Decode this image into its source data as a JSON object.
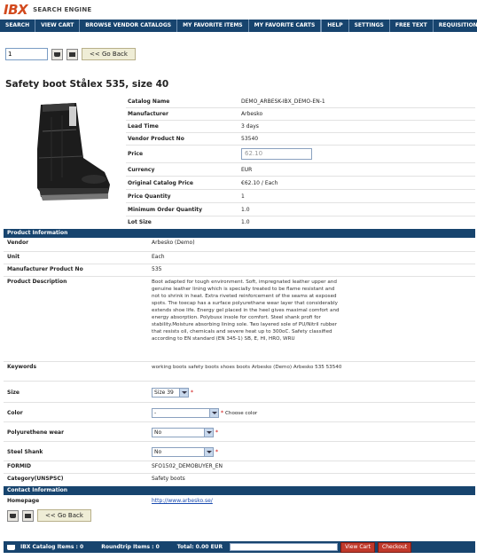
{
  "logo": "IBX",
  "logo_subtitle": "SEARCH ENGINE",
  "nav": {
    "left": [
      "SEARCH",
      "VIEW CART",
      "BROWSE VENDOR CATALOGS",
      "MY FAVORITE ITEMS",
      "MY FAVORITE CARTS"
    ],
    "right": [
      "HELP",
      "SETTINGS",
      "FREE TEXT",
      "REQUISITION"
    ]
  },
  "toolbar": {
    "quantity": "1",
    "back_label": "<< Go Back"
  },
  "product": {
    "title": "Safety boot Stålex 535, size 40",
    "specs": [
      {
        "label": "Catalog Name",
        "value": "DEMO_ARBESK-IBX_DEMO-EN-1"
      },
      {
        "label": "Manufacturer",
        "value": "Arbesko"
      },
      {
        "label": "Lead Time",
        "value": "3 days"
      },
      {
        "label": "Vendor Product No",
        "value": "53540"
      },
      {
        "label": "Price",
        "value": "62.10"
      },
      {
        "label": "Currency",
        "value": "EUR"
      },
      {
        "label": "Original Catalog Price",
        "value": "€62.10  /  Each"
      },
      {
        "label": "Price Quantity",
        "value": "1"
      },
      {
        "label": "Minimum Order Quantity",
        "value": "1.0"
      },
      {
        "label": "Lot Size",
        "value": "1.0"
      }
    ]
  },
  "product_info": {
    "heading": "Product Information",
    "vendor_label": "Vendor",
    "vendor_value": "Arbesko (Demo)",
    "unit_label": "Unit",
    "unit_value": "Each",
    "mpn_label": "Manufacturer Product No",
    "mpn_value": "535",
    "description_label": "Product Description",
    "description_value": "Boot adapted for tough environment. Soft, impregnated leather upper and genuine leather lining which is specially treated to be flame resistant and not to shrink in heat. Extra riveted reinforcement of the seams at exposed spots. The toecap has a surface polyurethane wear layer that considerably extends shoe life. Energy gel placed in the heel gives maximal comfort and energy absorption. Polybusx insole for comfort. Steel shank profi for stability.Moisture absorbing lining sole. Two layered sole of PU/Nitril rubber that resists oil, chemicals and severe heat up to 300oC. Safety classified according to EN standard (EN 345-1) SB, E, HI, HRO, WRU",
    "keywords_label": "Keywords",
    "keywords_value": "working boots safety boots shoes boots Arbesko (Demo) Arbesko 535 53540",
    "size_label": "Size",
    "size_value": "Size 39",
    "color_label": "Color",
    "color_value": "-",
    "color_hint": "Choose color",
    "pu_label": "Polyurethene wear",
    "pu_value": "No",
    "shank_label": "Steel Shank",
    "shank_value": "No",
    "formid_label": "FORMID",
    "formid_value": "SFO1502_DEMOBUYER_EN",
    "category_label": "Category(UNSPSC)",
    "category_value": "Safety boots",
    "required_mark": "*"
  },
  "contact_info": {
    "heading": "Contact Information",
    "homepage_label": "Homepage",
    "homepage_value": "http://www.arbesko.se/"
  },
  "bottom": {
    "catalog_items": "IBX Catalog Items : 0",
    "roundtrip_items": "Roundtrip Items : 0",
    "total": "Total: 0.00 EUR",
    "view_cart": "View Cart",
    "checkout": "Checkout"
  },
  "colors": {
    "navy": "#17446e",
    "logo": "#d24a1e",
    "button_red": "#c0392b"
  }
}
